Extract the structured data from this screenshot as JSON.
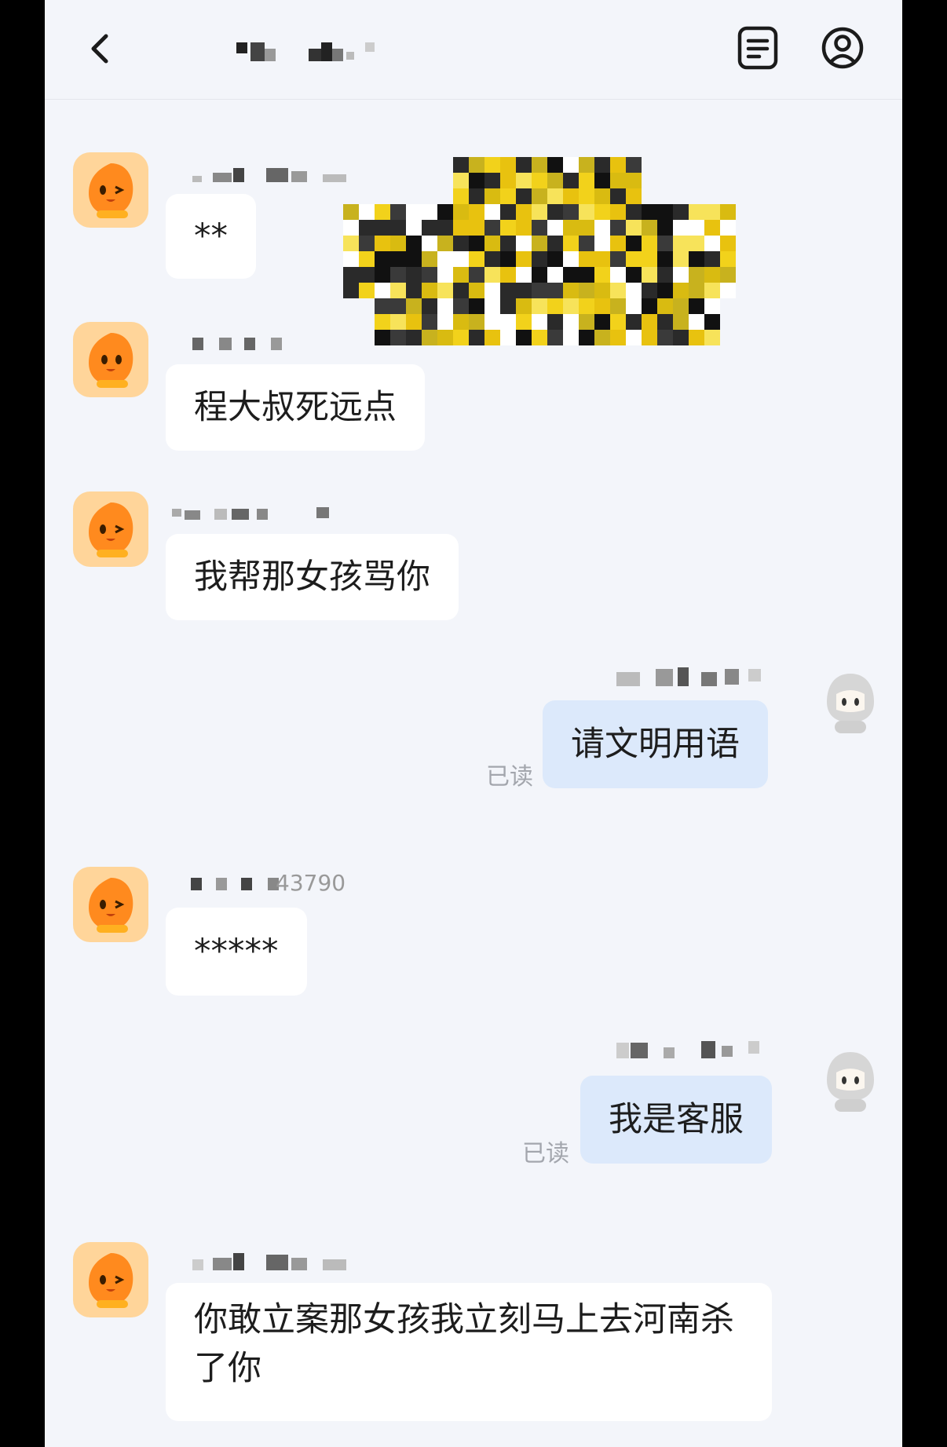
{
  "header": {
    "back_icon": "chevron-left-icon",
    "notes_icon": "document-lines-icon",
    "profile_icon": "user-circle-icon"
  },
  "messages": [
    {
      "side": "left",
      "avatar": "orange-mascot-icon",
      "text": "**"
    },
    {
      "side": "left",
      "avatar": "orange-mascot-icon",
      "text": "程大叔死远点"
    },
    {
      "side": "left",
      "avatar": "orange-mascot-icon",
      "text": "我帮那女孩骂你"
    },
    {
      "side": "right",
      "avatar": "gray-hooded-agent-icon",
      "text": "请文明用语",
      "status": "已读"
    },
    {
      "side": "left",
      "avatar": "orange-mascot-icon",
      "sender_fragment": "43790",
      "text": "*****"
    },
    {
      "side": "right",
      "avatar": "gray-hooded-agent-icon",
      "text": "我是客服",
      "status": "已读"
    },
    {
      "side": "left",
      "avatar": "orange-mascot-icon",
      "text": "你敢立案那女孩我立刻马上去河南杀了你"
    }
  ],
  "colors": {
    "background": "#f3f5fa",
    "bubble_incoming": "#ffffff",
    "bubble_outgoing": "#dce9fb",
    "read_status": "#a3a6ad",
    "mascot_orange": "#ff8a1e"
  }
}
